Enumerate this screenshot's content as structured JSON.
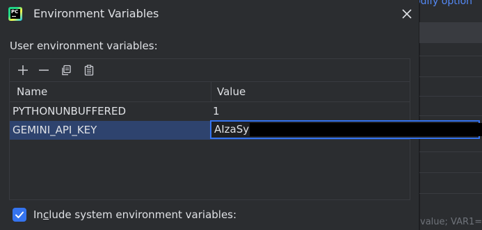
{
  "background": {
    "link_text": "odify option",
    "footer_text": "value; VAR1="
  },
  "dialog": {
    "title": "Environment Variables",
    "section_label": "User environment variables:",
    "toolbar": {
      "add_icon": "plus-icon",
      "remove_icon": "minus-icon",
      "copy_icon": "copy-icon",
      "paste_icon": "paste-icon"
    },
    "table": {
      "columns": [
        "Name",
        "Value"
      ],
      "rows": [
        {
          "name": "PYTHONUNBUFFERED",
          "value": "1"
        },
        {
          "name": "GEMINI_API_KEY",
          "value": "AIzaSy"
        }
      ],
      "selected_row": 1
    },
    "include_system": {
      "label_prefix": "In",
      "label_mnemonic": "c",
      "label_suffix": "lude system environment variables:",
      "checked": true
    }
  },
  "colors": {
    "accent": "#3574f0",
    "selection": "#2e436e",
    "background": "#2b2d30"
  }
}
